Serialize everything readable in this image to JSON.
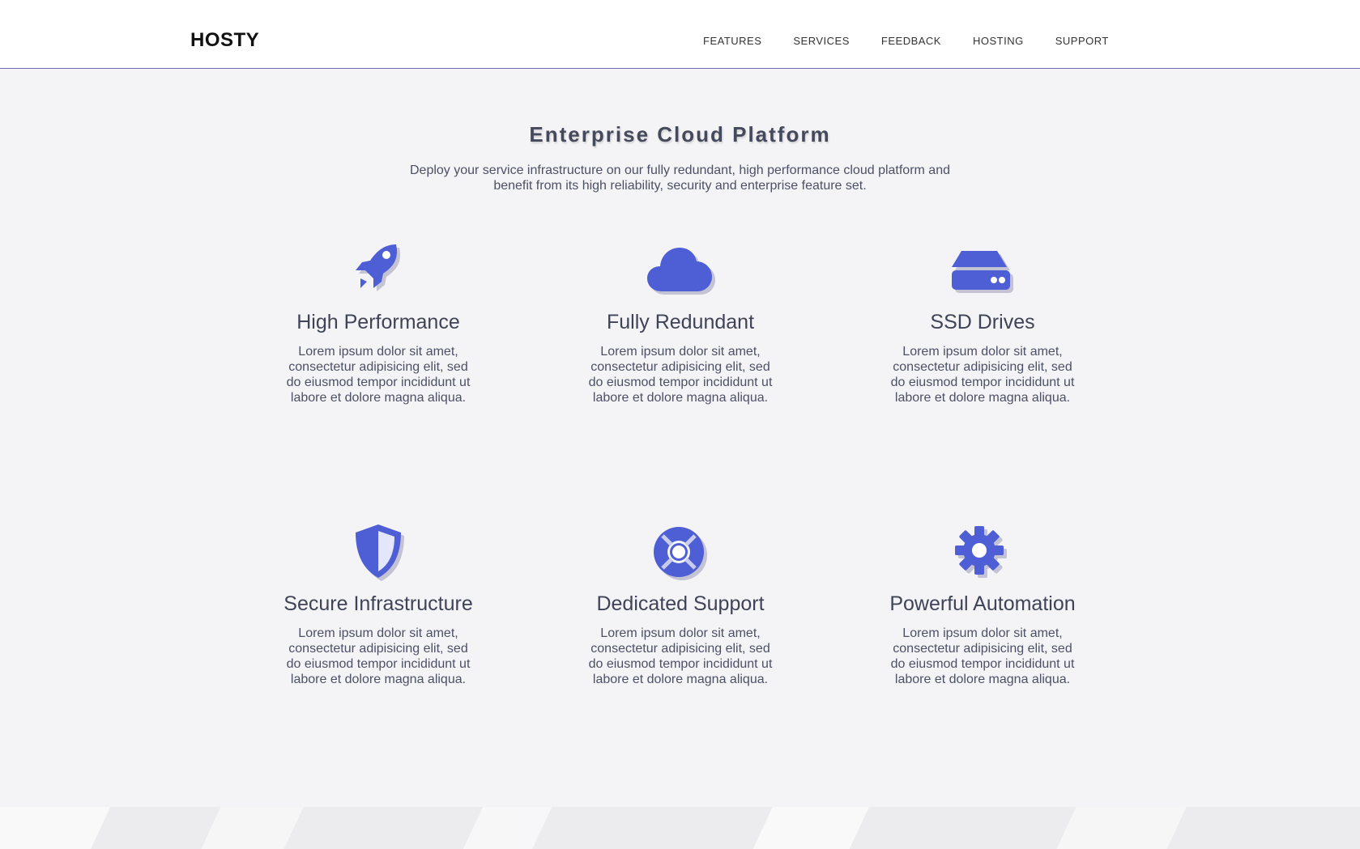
{
  "header": {
    "logo": "HOSTY",
    "nav": [
      "FEATURES",
      "SERVICES",
      "FEEDBACK",
      "HOSTING",
      "SUPPORT"
    ]
  },
  "hero": {
    "title": "Enterprise Cloud Platform",
    "description": "Deploy your service infrastructure on our fully redundant, high performance cloud platform and benefit from its high reliability, security and enterprise feature set."
  },
  "features": [
    {
      "icon": "rocket-icon",
      "title": "High Performance",
      "text": "Lorem ipsum dolor sit amet, consectetur adipisicing elit, sed do eiusmod tempor incididunt ut labore et dolore magna aliqua."
    },
    {
      "icon": "cloud-icon",
      "title": "Fully Redundant",
      "text": "Lorem ipsum dolor sit amet, consectetur adipisicing elit, sed do eiusmod tempor incididunt ut labore et dolore magna aliqua."
    },
    {
      "icon": "hdd-icon",
      "title": "SSD Drives",
      "text": "Lorem ipsum dolor sit amet, consectetur adipisicing elit, sed do eiusmod tempor incididunt ut labore et dolore magna aliqua."
    },
    {
      "icon": "shield-icon",
      "title": "Secure Infrastructure",
      "text": "Lorem ipsum dolor sit amet, consectetur adipisicing elit, sed do eiusmod tempor incididunt ut labore et dolore magna aliqua."
    },
    {
      "icon": "lifebuoy-icon",
      "title": "Dedicated Support",
      "text": "Lorem ipsum dolor sit amet, consectetur adipisicing elit, sed do eiusmod tempor incididunt ut labore et dolore magna aliqua."
    },
    {
      "icon": "gear-icon",
      "title": "Powerful Automation",
      "text": "Lorem ipsum dolor sit amet, consectetur adipisicing elit, sed do eiusmod tempor incididunt ut labore et dolore magna aliqua."
    }
  ],
  "colors": {
    "accent": "#4e5fd6",
    "shadow": "#c3c3d3"
  }
}
